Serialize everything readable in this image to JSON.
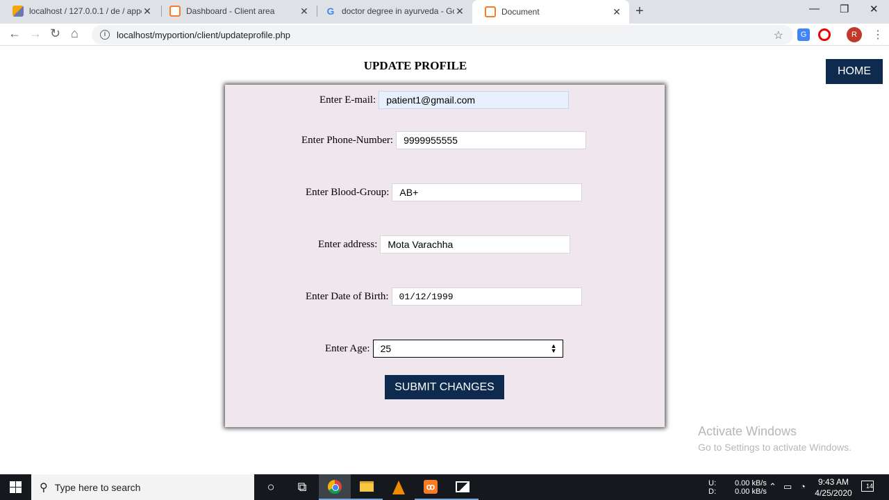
{
  "browser": {
    "tabs": [
      {
        "title": "localhost / 127.0.0.1 / de / appoi",
        "icon": "phpmyadmin-icon"
      },
      {
        "title": "Dashboard - Client area",
        "icon": "xampp-icon"
      },
      {
        "title": "doctor degree in ayurveda - Goo",
        "icon": "google-icon"
      },
      {
        "title": "Document",
        "icon": "xampp-icon"
      }
    ],
    "url": "localhost/myportion/client/updateprofile.php",
    "profile_initial": "R"
  },
  "page": {
    "title": "UPDATE PROFILE",
    "home_label": "HOME",
    "form": {
      "email_label": "Enter E-mail:",
      "email_value": "patient1@gmail.com",
      "phone_label": "Enter Phone-Number:",
      "phone_value": "9999955555",
      "blood_label": "Enter Blood-Group:",
      "blood_value": "AB+",
      "address_label": "Enter address:",
      "address_value": "Mota Varachha",
      "dob_label": "Enter Date of Birth:",
      "dob_value": "01/12/1999",
      "age_label": "Enter Age:",
      "age_value": "25",
      "submit_label": "SUBMIT CHANGES"
    },
    "watermark": {
      "line1": "Activate Windows",
      "line2": "Go to Settings to activate Windows."
    }
  },
  "taskbar": {
    "search_placeholder": "Type here to search",
    "net_up_label": "U:",
    "net_down_label": "D:",
    "net_up_value": "0.00 kB/s",
    "net_down_value": "0.00 kB/s",
    "time": "9:43 AM",
    "date": "4/25/2020",
    "notification_count": "14"
  }
}
